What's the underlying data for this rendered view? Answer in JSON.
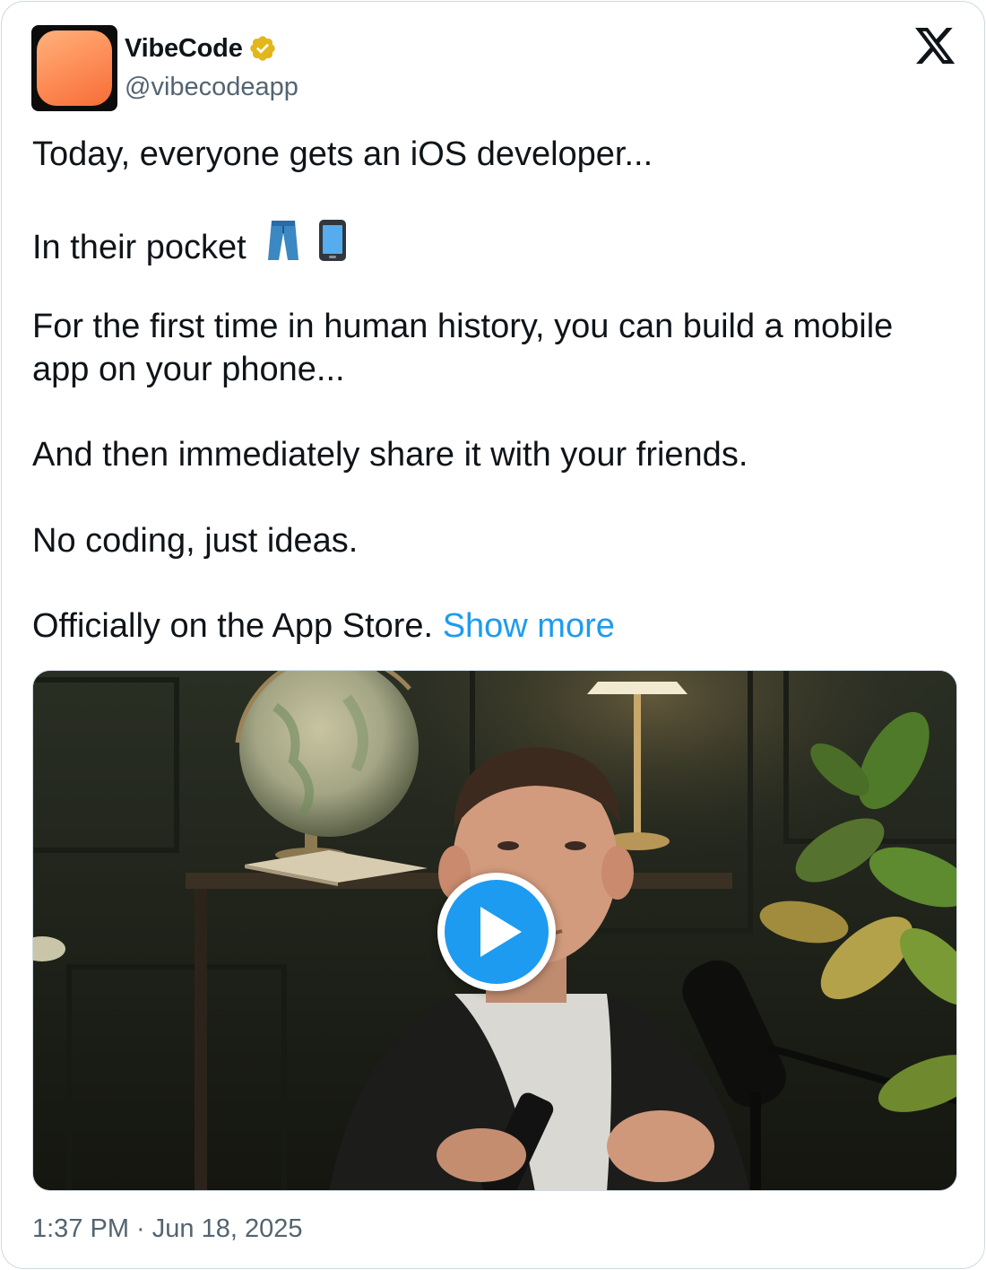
{
  "author": {
    "display_name": "VibeCode",
    "handle": "@vibecodeapp",
    "verified": true
  },
  "tweet": {
    "line1": "Today, everyone gets an iOS developer...",
    "line2": "In their pocket",
    "line2_emojis": [
      "jeans-emoji",
      "mobile-phone-emoji"
    ],
    "line3": "For the first time in human history, you can build a mobile app on your phone...",
    "line4": "And then immediately share it with your friends.",
    "line5": "No coding, just ideas.",
    "line6": "Officially on the App Store.",
    "show_more": "Show more"
  },
  "media": {
    "type": "video",
    "play_icon": "play-icon"
  },
  "timestamp": "1:37 PM · Jun 18, 2025",
  "colors": {
    "link": "#1d9bf0",
    "secondary_text": "#536471",
    "verified_badge": "#e2b719",
    "border": "#cfd9de"
  }
}
